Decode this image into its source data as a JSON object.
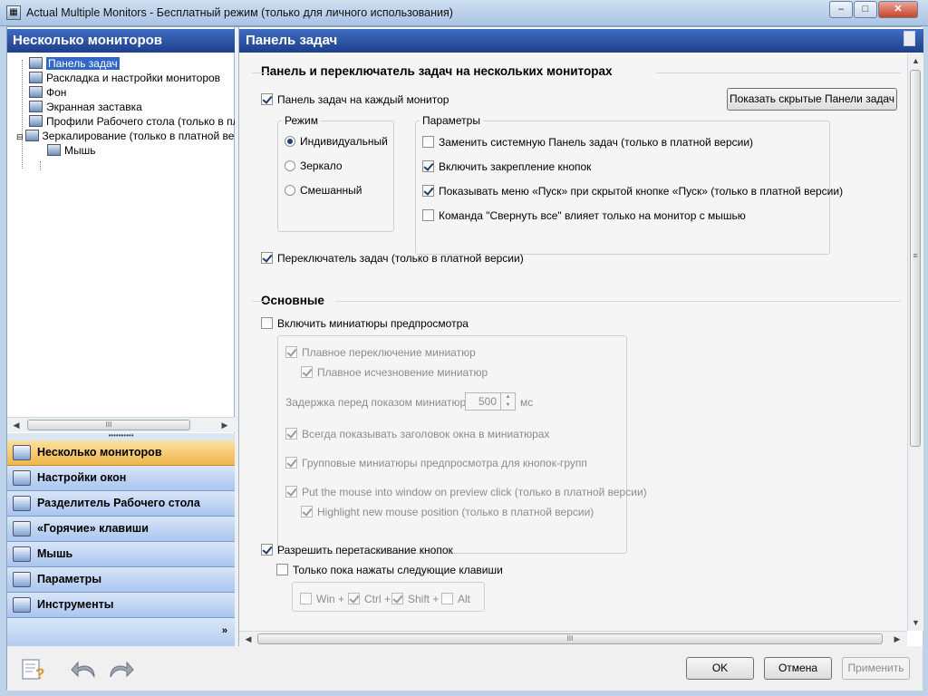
{
  "window": {
    "title": "Actual Multiple Monitors - Бесплатный режим (только для личного использования)",
    "min": "–",
    "max": "□",
    "close": "✕"
  },
  "left": {
    "header": "Несколько мониторов",
    "tree": [
      {
        "label": "Панель задач",
        "icon": "taskbar-icon"
      },
      {
        "label": "Раскладка и настройки мониторов",
        "icon": "monitor-layout-icon"
      },
      {
        "label": "Фон",
        "icon": "wallpaper-icon"
      },
      {
        "label": "Экранная заставка",
        "icon": "screensaver-icon"
      },
      {
        "label": "Профили Рабочего стола (только в плат",
        "icon": "desktop-profile-icon"
      },
      {
        "label": "Зеркалирование (только в платной верс",
        "icon": "mirroring-icon"
      },
      {
        "label": "Мышь",
        "icon": "mouse-icon"
      }
    ],
    "scroll_thumb": "III",
    "splitter": "••••••••••",
    "nav": [
      {
        "label": "Несколько мониторов",
        "icon": "multi-monitor-icon"
      },
      {
        "label": "Настройки окон",
        "icon": "window-settings-icon"
      },
      {
        "label": "Разделитель Рабочего стола",
        "icon": "desktop-divider-icon"
      },
      {
        "label": "«Горячие» клавиши",
        "icon": "hotkeys-icon"
      },
      {
        "label": "Мышь",
        "icon": "mouse-icon"
      },
      {
        "label": "Параметры",
        "icon": "options-icon"
      },
      {
        "label": "Инструменты",
        "icon": "tools-icon"
      }
    ],
    "more": "»"
  },
  "right": {
    "header": "Панель задач",
    "section1": {
      "title": "Панель и переключатель задач на нескольких мониторах",
      "taskbar_each_monitor": "Панель задач на каждый монитор",
      "show_hidden_button": "Показать скрытые Панели задач",
      "mode_title": "Режим",
      "modes": [
        "Индивидуальный",
        "Зеркало",
        "Смешанный"
      ],
      "params_title": "Параметры",
      "params": [
        "Заменить системную Панель задач (только в платной версии)",
        "Включить закрепление кнопок",
        "Показывать меню «Пуск» при скрытой кнопке «Пуск» (только в платной версии)",
        "Команда \"Свернуть все\" влияет только на монитор с мышью"
      ],
      "task_switcher": "Переключатель задач (только в платной версии)"
    },
    "section2": {
      "title": "Основные",
      "enable_thumbnails": "Включить миниатюры предпросмотра",
      "smooth_switch": "Плавное переключение миниатюр",
      "smooth_fade": "Плавное исчезновение миниатюр",
      "delay_label": "Задержка перед показом миниатюры:",
      "delay_value": "500",
      "delay_unit": "мс",
      "always_title": "Всегда показывать заголовок окна в миниатюрах",
      "group_thumbs": "Групповые миниатюры предпросмотра для кнопок-групп",
      "mouse_into": "Put the mouse into window on preview click (только в платной версии)",
      "highlight_mouse": "Highlight new mouse position (только в платной версии)",
      "allow_drag": "Разрешить перетаскивание кнопок",
      "only_keys": "Только пока нажаты следующие клавиши",
      "keys": [
        "Win +",
        "Ctrl +",
        "Shift +",
        "Alt"
      ]
    },
    "scroll_thumb": "III",
    "vscroll_thumb": "≡"
  },
  "buttons": {
    "ok": "OK",
    "cancel": "Отмена",
    "apply": "Применить"
  }
}
